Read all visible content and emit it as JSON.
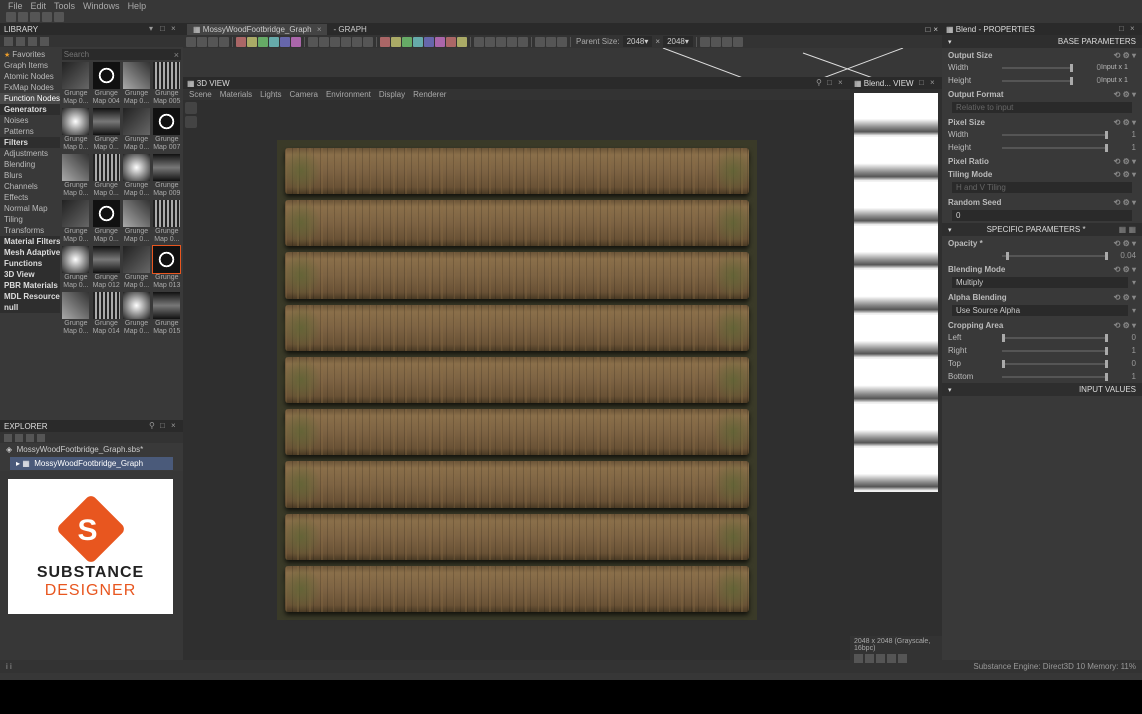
{
  "menubar": [
    "File",
    "Edit",
    "Tools",
    "Windows",
    "Help"
  ],
  "library": {
    "title": "LIBRARY",
    "search_placeholder": "Search",
    "tree": [
      {
        "label": "Favorites",
        "cls": "fav"
      },
      {
        "label": "Graph Items"
      },
      {
        "label": "Atomic Nodes"
      },
      {
        "label": "FxMap Nodes"
      },
      {
        "label": "Function Nodes",
        "cls": "sel"
      },
      {
        "label": "Generators",
        "cls": "hdr"
      },
      {
        "label": "Noises"
      },
      {
        "label": "Patterns"
      },
      {
        "label": "Filters",
        "cls": "hdr"
      },
      {
        "label": "Adjustments"
      },
      {
        "label": "Blending"
      },
      {
        "label": "Blurs"
      },
      {
        "label": "Channels"
      },
      {
        "label": "Effects"
      },
      {
        "label": "Normal Map"
      },
      {
        "label": "Tiling"
      },
      {
        "label": "Transforms"
      },
      {
        "label": "Material Filters",
        "cls": "hdr"
      },
      {
        "label": "Mesh Adaptive",
        "cls": "hdr"
      },
      {
        "label": "Functions",
        "cls": "hdr"
      },
      {
        "label": "3D View",
        "cls": "hdr"
      },
      {
        "label": "PBR Materials",
        "cls": "hdr"
      },
      {
        "label": "MDL Resources",
        "cls": "hdr"
      },
      {
        "label": "null",
        "cls": "hdr"
      }
    ],
    "thumbs": [
      {
        "name": "Grunge Map 0...",
        "t": "t1"
      },
      {
        "name": "Grunge Map 004",
        "t": "t2"
      },
      {
        "name": "Grunge Map 0...",
        "t": "t3"
      },
      {
        "name": "Grunge Map 005",
        "t": "t4"
      },
      {
        "name": "Grunge Map 0...",
        "t": "t5"
      },
      {
        "name": "Grunge Map 0...",
        "t": "t6"
      },
      {
        "name": "Grunge Map 0...",
        "t": "t1"
      },
      {
        "name": "Grunge Map 007",
        "t": "t2"
      },
      {
        "name": "Grunge Map 0...",
        "t": "t3"
      },
      {
        "name": "Grunge Map 0...",
        "t": "t4"
      },
      {
        "name": "Grunge Map 0...",
        "t": "t5"
      },
      {
        "name": "Grunge Map 009",
        "t": "t6"
      },
      {
        "name": "Grunge Map 0...",
        "t": "t1"
      },
      {
        "name": "Grunge Map 0...",
        "t": "t2"
      },
      {
        "name": "Grunge Map 0...",
        "t": "t3"
      },
      {
        "name": "Grunge Map 0...",
        "t": "t4"
      },
      {
        "name": "Grunge Map 0...",
        "t": "t5"
      },
      {
        "name": "Grunge Map 012",
        "t": "t6"
      },
      {
        "name": "Grunge Map 0...",
        "t": "t1"
      },
      {
        "name": "Grunge Map 013",
        "t": "t2",
        "sel": true
      },
      {
        "name": "Grunge Map 0...",
        "t": "t3"
      },
      {
        "name": "Grunge Map 014",
        "t": "t4"
      },
      {
        "name": "Grunge Map 0...",
        "t": "t5"
      },
      {
        "name": "Grunge Map 015",
        "t": "t6"
      }
    ]
  },
  "explorer": {
    "title": "EXPLORER",
    "file": "MossyWoodFootbridge_Graph.sbs*",
    "graph": "MossyWoodFootbridge_Graph"
  },
  "logo": {
    "line1": "SUBSTANCE",
    "line2": "DESIGNER"
  },
  "graph": {
    "tab": "MossyWoodFootbridge_Graph",
    "suffix": "- GRAPH",
    "parent_size_label": "Parent Size:",
    "parent_w": "2048",
    "parent_h": "2048"
  },
  "view3d": {
    "title": "3D VIEW",
    "menu": [
      "Scene",
      "Materials",
      "Lights",
      "Camera",
      "Environment",
      "Display",
      "Renderer"
    ]
  },
  "view2d": {
    "title": "Blend... VIEW",
    "status": "2048 x 2048 (Grayscale, 16bpc)"
  },
  "properties": {
    "title": "Blend - PROPERTIES",
    "base_section": "BASE PARAMETERS",
    "output_size": "Output Size",
    "width": "Width",
    "height": "Height",
    "input_x1": "Input x 1",
    "zero": "0",
    "output_format": "Output Format",
    "pixel_size": "Pixel Size",
    "width_val": "1",
    "height_val": "1",
    "pixel_ratio": "Pixel Ratio",
    "tiling_mode": "Tiling Mode",
    "tiling_val": "H and V Tiling",
    "random_seed": "Random Seed",
    "seed_val": "0",
    "specific_section": "SPECIFIC PARAMETERS *",
    "opacity": "Opacity *",
    "opacity_val": "0.04",
    "blending_mode": "Blending Mode",
    "blending_val": "Multiply",
    "alpha_blending": "Alpha Blending",
    "alpha_val": "Use Source Alpha",
    "cropping": "Cropping Area",
    "left": "Left",
    "right": "Right",
    "top": "Top",
    "bottom": "Bottom",
    "crop_l": "0",
    "crop_r": "1",
    "crop_t": "0",
    "crop_b": "1",
    "input_section": "INPUT VALUES"
  },
  "statusbar": {
    "left": "i    i",
    "right": "Substance Engine: Direct3D 10   Memory: 11%"
  }
}
